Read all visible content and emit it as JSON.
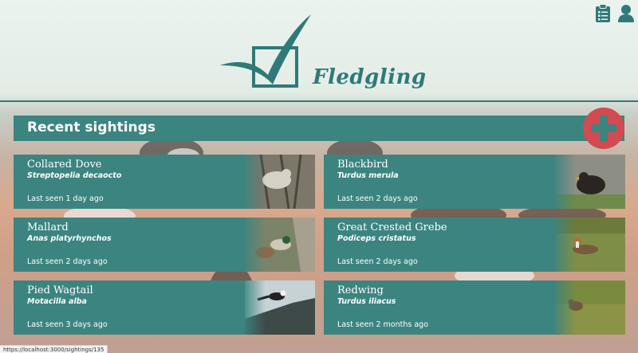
{
  "app": {
    "name": "Fledgling"
  },
  "header": {
    "icons": [
      "clipboard-list-icon",
      "user-icon"
    ]
  },
  "recent": {
    "title": "Recent sightings",
    "add_icon": "plus-icon"
  },
  "sightings": [
    {
      "name": "Collared Dove",
      "latin": "Streptopelia decaocto",
      "seen": "Last seen 1 day ago"
    },
    {
      "name": "Blackbird",
      "latin": "Turdus merula",
      "seen": "Last seen 2 days ago"
    },
    {
      "name": "Mallard",
      "latin": "Anas platyrhynchos",
      "seen": "Last seen 2 days ago"
    },
    {
      "name": "Great Crested Grebe",
      "latin": "Podiceps cristatus",
      "seen": "Last seen 2 days ago"
    },
    {
      "name": "Pied Wagtail",
      "latin": "Motacilla alba",
      "seen": "Last seen 3 days ago"
    },
    {
      "name": "Redwing",
      "latin": "Turdus iliacus",
      "seen": "Last seen 2 months ago"
    }
  ],
  "status_bar": {
    "url": "https://localhost:3000/sightings/135"
  },
  "colors": {
    "accent": "#3c8480",
    "add_button": "#d14b50",
    "brand": "#2f7a78"
  }
}
